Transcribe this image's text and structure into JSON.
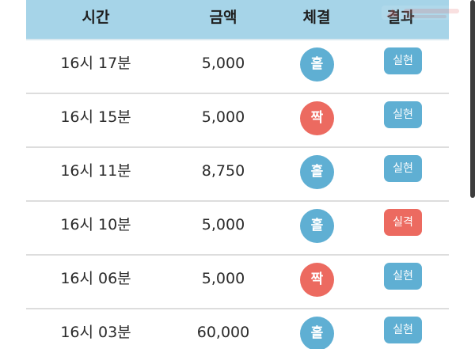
{
  "table": {
    "headers": {
      "time": "시간",
      "amount": "금액",
      "type": "체결",
      "result": "결과"
    },
    "rows": [
      {
        "time": "16시 17분",
        "amount": "5,000",
        "type": "홀",
        "result": "실현"
      },
      {
        "time": "16시 15분",
        "amount": "5,000",
        "type": "짝",
        "result": "실현"
      },
      {
        "time": "16시 11분",
        "amount": "8,750",
        "type": "홀",
        "result": "실현"
      },
      {
        "time": "16시 10분",
        "amount": "5,000",
        "type": "홀",
        "result": "실격"
      },
      {
        "time": "16시 06분",
        "amount": "5,000",
        "type": "짝",
        "result": "실현"
      },
      {
        "time": "16시 03분",
        "amount": "60,000",
        "type": "홀",
        "result": "실현"
      }
    ]
  },
  "colors": {
    "header_bg": "#a6d4e8",
    "odd_blue": "#5fafd3",
    "even_red": "#ec6a60",
    "success_blue": "#5fafd3",
    "fail_red": "#ec6a60"
  },
  "watermark": {
    "icon": "watermark-logo-icon"
  }
}
